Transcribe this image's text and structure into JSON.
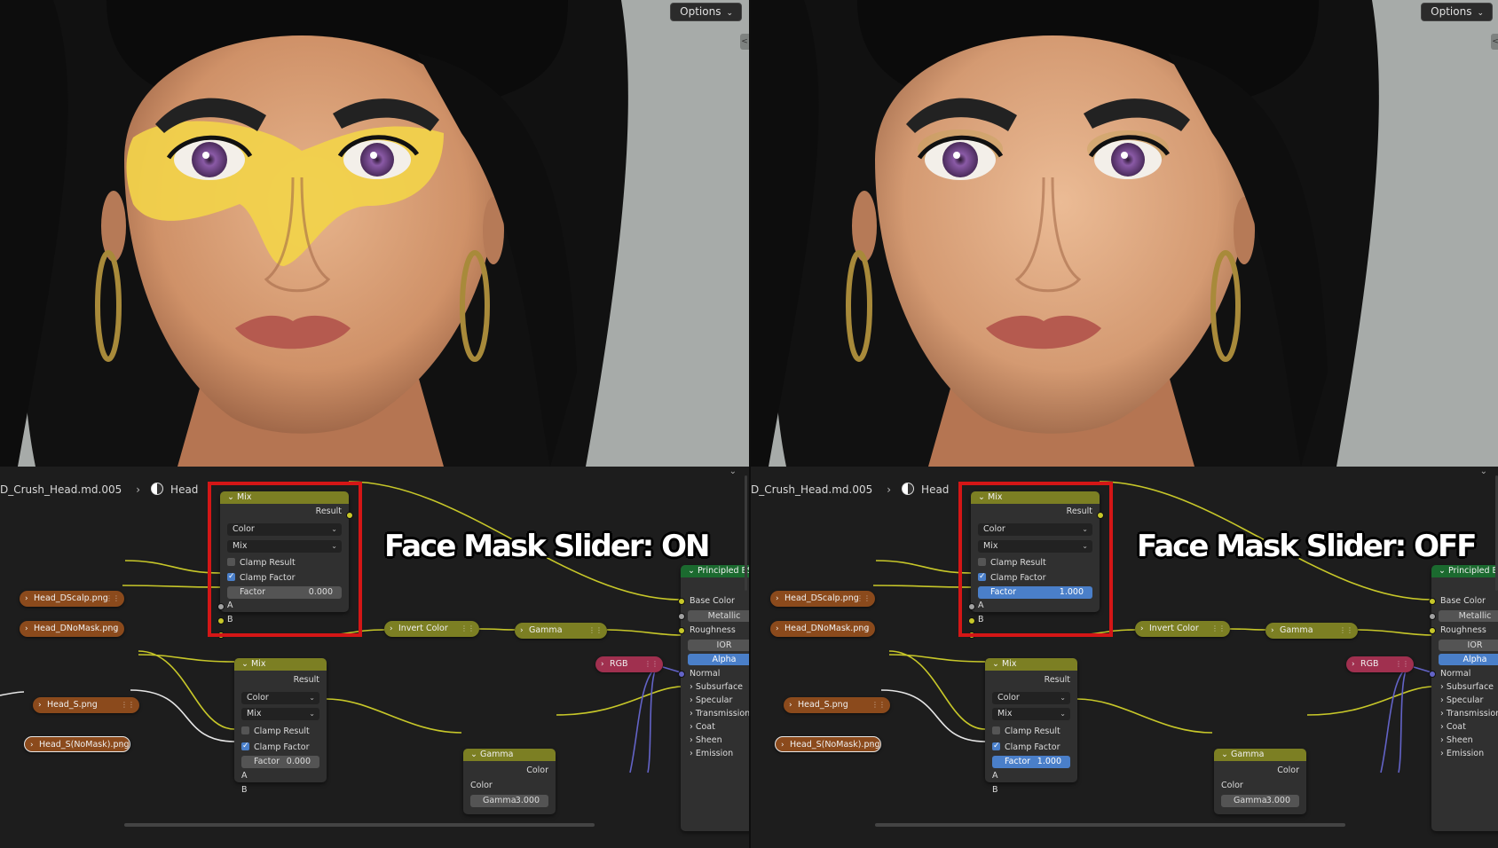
{
  "colors": {
    "mix_header": "#7c7f23",
    "bsdf_header": "#1b6a2f",
    "texture_node": "#8b4a1c",
    "rgb_node": "#a0304f",
    "highlight": "#d41616",
    "slider_full": "#4a7fc9",
    "wire_color": "#c7c729",
    "wire_grey": "#a1a1a1",
    "wire_blue": "#6363c7"
  },
  "panels": [
    {
      "viewport": {
        "options_label": "Options",
        "mask": true
      },
      "breadcrumb": {
        "object": "D_Crush_Head.md.005",
        "material": "Head"
      },
      "caption": "Face Mask Slider: ON",
      "mix_top": {
        "title": "Mix",
        "output": "Result",
        "data_type": "Color",
        "blend": "Mix",
        "clamp_result_label": "Clamp Result",
        "clamp_result": false,
        "clamp_factor_label": "Clamp Factor",
        "clamp_factor": true,
        "factor_label": "Factor",
        "factor_value": "0.000",
        "factor": 0.0,
        "input_a": "A",
        "input_b": "B"
      },
      "mix_bottom": {
        "title": "Mix",
        "output": "Result",
        "data_type": "Color",
        "blend": "Mix",
        "clamp_result_label": "Clamp Result",
        "clamp_result": false,
        "clamp_factor_label": "Clamp Factor",
        "clamp_factor": true,
        "factor_label": "Factor",
        "factor_value": "0.000",
        "factor": 0.0,
        "input_a": "A",
        "input_b": "B"
      },
      "textures": [
        "Head_DScalp.png",
        "Head_DNoMask.png",
        "Head_S.png",
        "Head_S(NoMask).png"
      ],
      "invert": "Invert Color",
      "gamma_pill": "Gamma",
      "rgb": "RGB",
      "gamma_node": {
        "title": "Gamma",
        "output": "Color",
        "input": "Color",
        "gamma_label": "Gamma",
        "gamma_value": "3.000"
      },
      "bsdf": {
        "title": "Principled BSDF",
        "inputs": [
          "Base Color",
          "Metallic",
          "Roughness",
          "IOR",
          "Alpha",
          "Normal"
        ],
        "panels": [
          "Subsurface",
          "Specular",
          "Transmission",
          "Coat",
          "Sheen",
          "Emission"
        ]
      }
    },
    {
      "viewport": {
        "options_label": "Options",
        "mask": false
      },
      "breadcrumb": {
        "object": "D_Crush_Head.md.005",
        "material": "Head"
      },
      "caption": "Face Mask Slider: OFF",
      "mix_top": {
        "title": "Mix",
        "output": "Result",
        "data_type": "Color",
        "blend": "Mix",
        "clamp_result_label": "Clamp Result",
        "clamp_result": false,
        "clamp_factor_label": "Clamp Factor",
        "clamp_factor": true,
        "factor_label": "Factor",
        "factor_value": "1.000",
        "factor": 1.0,
        "input_a": "A",
        "input_b": "B"
      },
      "mix_bottom": {
        "title": "Mix",
        "output": "Result",
        "data_type": "Color",
        "blend": "Mix",
        "clamp_result_label": "Clamp Result",
        "clamp_result": false,
        "clamp_factor_label": "Clamp Factor",
        "clamp_factor": true,
        "factor_label": "Factor",
        "factor_value": "1.000",
        "factor": 1.0,
        "input_a": "A",
        "input_b": "B"
      },
      "textures": [
        "Head_DScalp.png",
        "Head_DNoMask.png",
        "Head_S.png",
        "Head_S(NoMask).png"
      ],
      "invert": "Invert Color",
      "gamma_pill": "Gamma",
      "rgb": "RGB",
      "gamma_node": {
        "title": "Gamma",
        "output": "Color",
        "input": "Color",
        "gamma_label": "Gamma",
        "gamma_value": "3.000"
      },
      "bsdf": {
        "title": "Principled BSDF",
        "inputs": [
          "Base Color",
          "Metallic",
          "Roughness",
          "IOR",
          "Alpha",
          "Normal"
        ],
        "panels": [
          "Subsurface",
          "Specular",
          "Transmission",
          "Coat",
          "Sheen",
          "Emission"
        ]
      }
    }
  ]
}
